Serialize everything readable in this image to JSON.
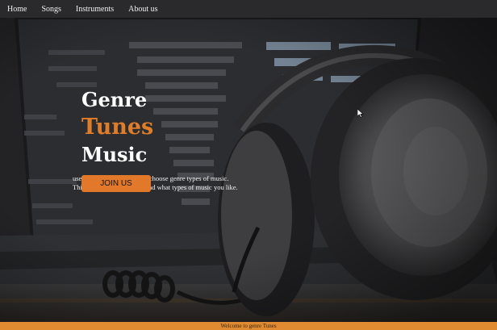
{
  "nav": {
    "items": [
      {
        "label": "Home"
      },
      {
        "label": "Songs"
      },
      {
        "label": "Instruments"
      },
      {
        "label": "About us"
      }
    ]
  },
  "hero": {
    "title_line1": "Genre",
    "title_line2": "Tunes",
    "title_line3": "Music",
    "description_line1": "user to sign up account and choose genre types of music.",
    "description_line2": "This will also help you to find what types of music you like.",
    "cta_label": "JOIN US",
    "background": "headphones-in-front-of-laptop-photo"
  },
  "footer": {
    "text": "Welcome to genre Tunes"
  },
  "colors": {
    "accent": "#e07d2a",
    "navbar": "#2a2a2c",
    "footer": "#e08a32"
  }
}
